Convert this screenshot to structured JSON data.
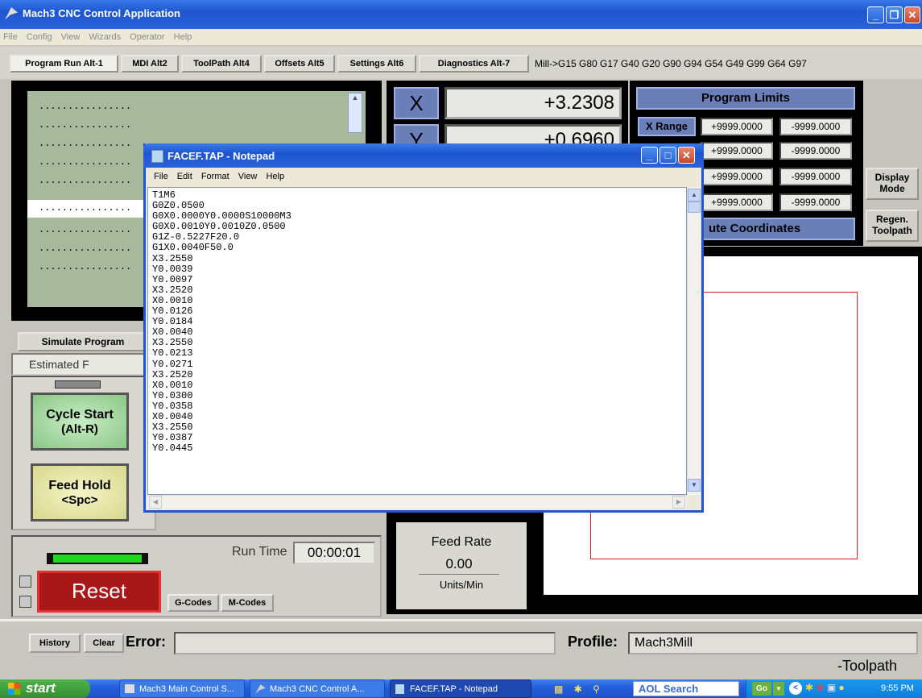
{
  "app": {
    "title": "Mach3 CNC Control Application",
    "menu": [
      "File",
      "Config",
      "View",
      "Wizards",
      "Operator",
      "Help"
    ]
  },
  "tabs": [
    "Program Run Alt-1",
    "MDI Alt2",
    "ToolPath Alt4",
    "Offsets Alt5",
    "Settings Alt6",
    "Diagnostics Alt-7"
  ],
  "modal_line": "Mill->G15  G80 G17 G40 G20 G90 G94 G54 G49 G99 G64 G97",
  "code_list": {
    "lines": [
      "................",
      "................",
      "................",
      "................",
      "................",
      "................",
      "................",
      "................",
      "................"
    ]
  },
  "dro": {
    "x_label": "X",
    "x_value": "+3.2308",
    "y_label": "Y",
    "y_value": "+0.6960"
  },
  "program_limits": {
    "title": "Program Limits",
    "x_range_label": "X Range",
    "rows": [
      [
        "+9999.0000",
        "-9999.0000"
      ],
      [
        "+9999.0000",
        "-9999.0000"
      ],
      [
        "+9999.0000",
        "-9999.0000"
      ],
      [
        "+9999.0000",
        "-9999.0000"
      ]
    ],
    "coords_label": "ute Coordinates"
  },
  "side_buttons": {
    "display_mode": "Display Mode",
    "regen": "Regen. Toolpath"
  },
  "controls": {
    "simulate": "Simulate Program",
    "estimated": "Estimated F",
    "cycle_start": "Cycle Start",
    "cycle_start_key": "(Alt-R)",
    "feed_hold": "Feed Hold",
    "feed_hold_key": "<Spc>",
    "run_time_label": "Run Time",
    "run_time_value": "00:00:01",
    "reset": "Reset",
    "gcodes": "G-Codes",
    "mcodes": "M-Codes"
  },
  "feed": {
    "label": "Feed Rate",
    "value": "0.00",
    "units": "Units/Min"
  },
  "status": {
    "history": "History",
    "clear": "Clear",
    "error_label": "Error:",
    "error_value": "",
    "profile_label": "Profile:",
    "profile_value": "Mach3Mill",
    "toolpath_label": "-Toolpath"
  },
  "notepad": {
    "title": "FACEF.TAP - Notepad",
    "menu": [
      "File",
      "Edit",
      "Format",
      "View",
      "Help"
    ],
    "content": "T1M6\nG0Z0.0500\nG0X0.0000Y0.0000S10000M3\nG0X0.0010Y0.0010Z0.0500\nG1Z-0.5227F20.0\nG1X0.0040F50.0\nX3.2550\nY0.0039\nY0.0097\nX3.2520\nX0.0010\nY0.0126\nY0.0184\nX0.0040\nX3.2550\nY0.0213\nY0.0271\nX3.2520\nX0.0010\nY0.0300\nY0.0358\nX0.0040\nX3.2550\nY0.0387\nY0.0445"
  },
  "taskbar": {
    "start": "start",
    "items": [
      "Mach3 Main Control S...",
      "Mach3 CNC Control A...",
      "FACEF.TAP - Notepad"
    ],
    "search_label": "AOL Search",
    "go_label": "Go",
    "clock": "9:55 PM"
  },
  "colors": {
    "xp_blue": "#2a62d8",
    "toolpath_red": "#e02020",
    "reset_red": "#a81818",
    "cycle_green": "#a4d4a0",
    "feedhold_yellow": "#e6e6a0"
  }
}
